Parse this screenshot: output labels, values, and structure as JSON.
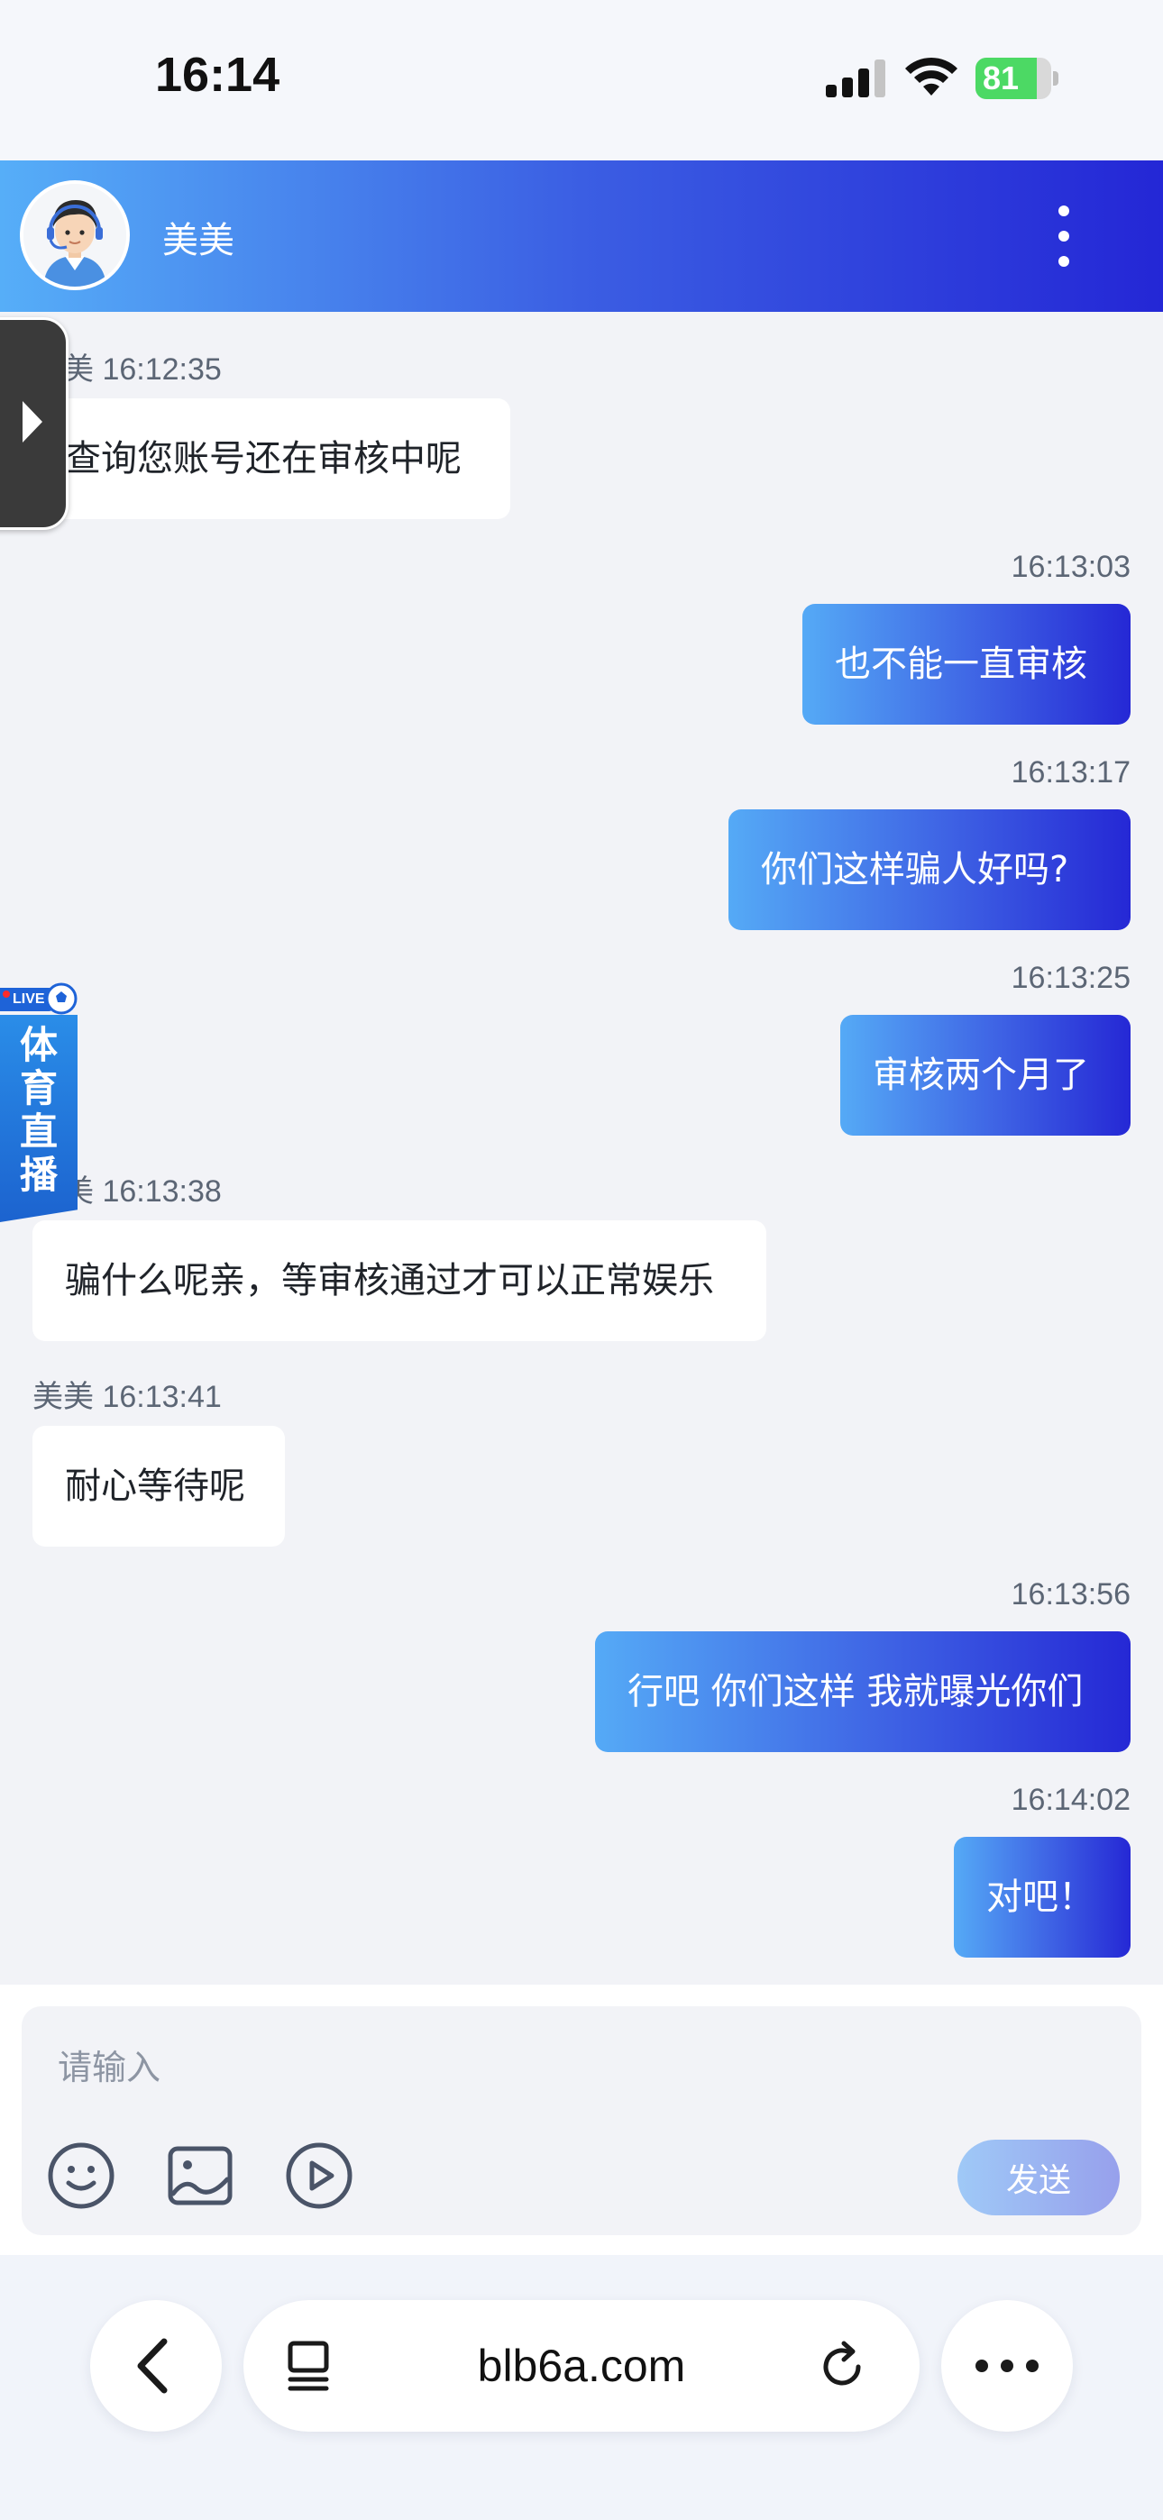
{
  "status_bar": {
    "time": "16:14",
    "battery_percent": "81",
    "battery_level": 0.81
  },
  "header": {
    "agent_name": "美美",
    "avatar_icon": "support-agent-avatar",
    "menu_icon": "more-vertical-icon",
    "gradient": [
      "#56aef8",
      "#2427d6"
    ]
  },
  "messages": [
    {
      "direction": "in",
      "meta": "美美 16:12:35",
      "text": "查询您账号还在审核中呢"
    },
    {
      "direction": "out",
      "meta": "16:13:03",
      "text": "也不能一直审核"
    },
    {
      "direction": "out",
      "meta": "16:13:17",
      "text": "你们这样骗人好吗?"
    },
    {
      "direction": "out",
      "meta": "16:13:25",
      "text": "审核两个月了"
    },
    {
      "direction": "in",
      "meta": "美美 16:13:38",
      "text": "骗什么呢亲，等审核通过才可以正常娱乐"
    },
    {
      "direction": "in",
      "meta": "美美 16:13:41",
      "text": "耐心等待呢"
    },
    {
      "direction": "out",
      "meta": "16:13:56",
      "text": "行吧 你们这样 我就曝光你们"
    },
    {
      "direction": "out",
      "meta": "16:14:02",
      "text": "对吧！"
    }
  ],
  "overlays": {
    "live_tag": "LIVE",
    "live_label": "体育直播"
  },
  "composer": {
    "placeholder": "请输入",
    "send_label": "发送",
    "tools": [
      "emoji-icon",
      "image-icon",
      "video-icon"
    ]
  },
  "browser": {
    "url": "blb6a.com"
  },
  "colors": {
    "background": "#f2f3f7",
    "incoming_bubble": "#ffffff",
    "outgoing_bubble_start": "#55aaf6",
    "outgoing_bubble_end": "#2528d5",
    "meta_text": "#5c6675"
  }
}
